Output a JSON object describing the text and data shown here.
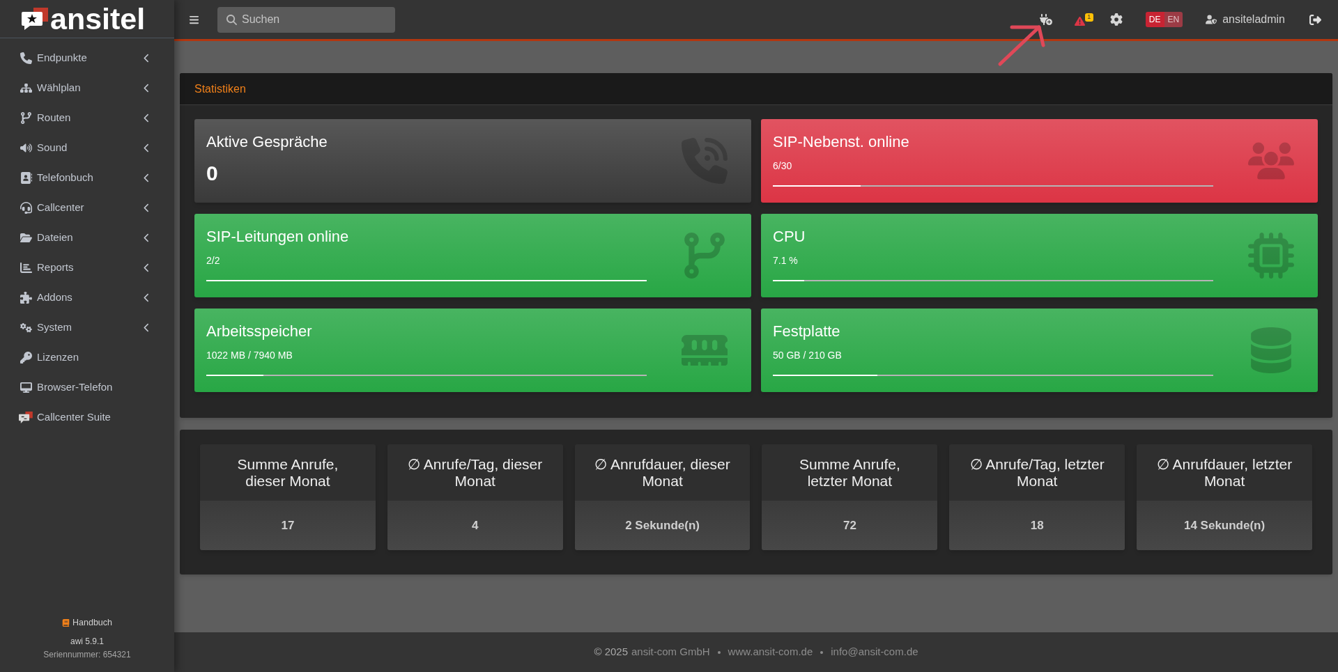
{
  "brand": {
    "name": "ansitel"
  },
  "sidebar": {
    "items": [
      {
        "label": "Endpunkte",
        "has_submenu": true
      },
      {
        "label": "Wählplan",
        "has_submenu": true
      },
      {
        "label": "Routen",
        "has_submenu": true
      },
      {
        "label": "Sound",
        "has_submenu": true
      },
      {
        "label": "Telefonbuch",
        "has_submenu": true
      },
      {
        "label": "Callcenter",
        "has_submenu": true
      },
      {
        "label": "Dateien",
        "has_submenu": true
      },
      {
        "label": "Reports",
        "has_submenu": true
      },
      {
        "label": "Addons",
        "has_submenu": true
      },
      {
        "label": "System",
        "has_submenu": true
      },
      {
        "label": "Lizenzen",
        "has_submenu": false
      },
      {
        "label": "Browser-Telefon",
        "has_submenu": false
      },
      {
        "label": "Callcenter Suite",
        "has_submenu": false
      }
    ],
    "manual_link": "Handbuch",
    "version": "awi 5.9.1",
    "serial": "Seriennummer: 654321"
  },
  "topbar": {
    "search": {
      "placeholder": "Suchen"
    },
    "alert_count": "1",
    "languages": [
      {
        "label": "DE",
        "selected": true
      },
      {
        "label": "EN",
        "selected": false
      }
    ],
    "user": "ansiteladmin"
  },
  "statistics": {
    "title": "Statistiken",
    "cards": [
      {
        "kind": "counter",
        "title": "Aktive Gespräche",
        "value": "0",
        "color": "#3a3a3a"
      },
      {
        "kind": "meter",
        "title": "SIP-Nebenst. online",
        "value": "6/30",
        "color": "#dc3545",
        "level": 0.2
      },
      {
        "kind": "meter",
        "title": "SIP-Leitungen online",
        "value": "2/2",
        "color": "#28a745",
        "level": 1
      },
      {
        "kind": "meter",
        "title": "CPU",
        "value": "7.1 %",
        "color": "#28a745",
        "level": 0.071
      },
      {
        "kind": "meter",
        "title": "Arbeitsspeicher",
        "value": "1022 MB / 7940 MB",
        "color": "#28a745",
        "level": 0.129
      },
      {
        "kind": "meter",
        "title": "Festplatte",
        "value": "50 GB / 210 GB",
        "color": "#28a745",
        "level": 0.238
      }
    ]
  },
  "summary": [
    {
      "label": "Summe Anrufe, dieser Monat",
      "value": "17"
    },
    {
      "label": "∅ Anrufe/Tag, dieser Monat",
      "value": "4"
    },
    {
      "label": "∅ Anrufdauer, dieser Monat",
      "value": "2 Sekunde(n)"
    },
    {
      "label": "Summe Anrufe, letzter Monat",
      "value": "72"
    },
    {
      "label": "∅ Anrufe/Tag, letzter Monat",
      "value": "18"
    },
    {
      "label": "∅ Anrufdauer, letzter Monat",
      "value": "14 Sekunde(n)"
    }
  ],
  "footer": {
    "copyright": "© 2025",
    "company": "ansit-com GmbH",
    "links": [
      "www.ansit-com.de",
      "info@ansit-com.de"
    ]
  }
}
